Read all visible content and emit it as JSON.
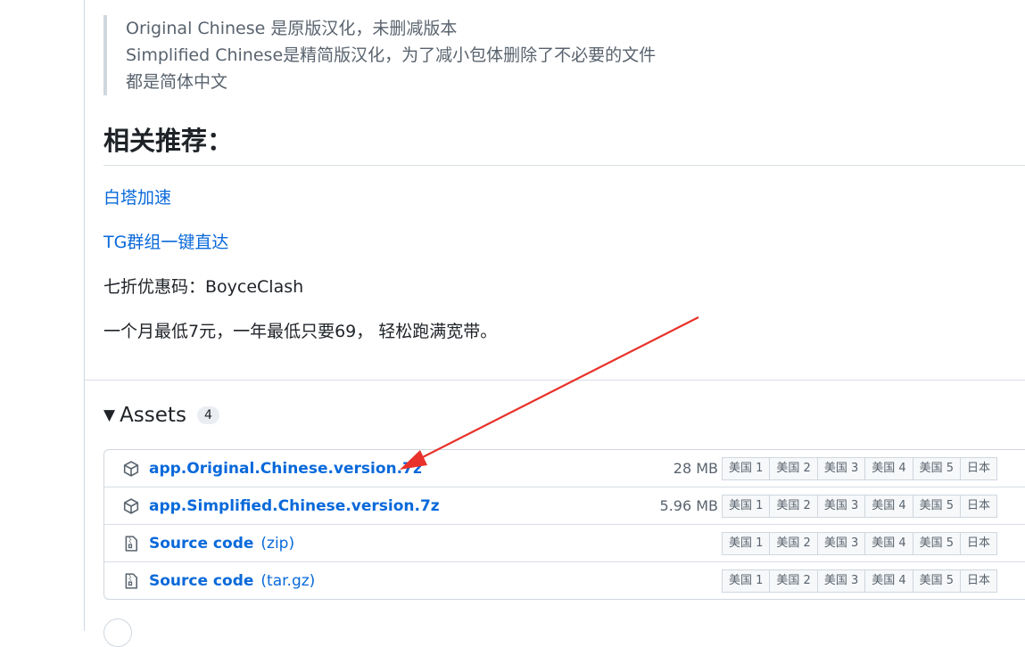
{
  "quote": {
    "lines": [
      "Original Chinese 是原版汉化，未删减版本",
      "Simplified Chinese是精简版汉化，为了减小包体删除了不必要的文件",
      "都是简体中文"
    ]
  },
  "recommend": {
    "heading": "相关推荐：",
    "link1": "白塔加速",
    "link2": "TG群组一键直达",
    "coupon": "七折优惠码：BoyceClash",
    "price": "一个月最低7元，一年最低只要69， 轻松跑满宽带。"
  },
  "assets": {
    "title": "Assets",
    "count": "4",
    "rows": [
      {
        "name": "app.Original.Chinese.version.7z",
        "ext": "",
        "size": "28 MB",
        "icon": "package-icon"
      },
      {
        "name": "app.Simplified.Chinese.version.7z",
        "ext": "",
        "size": "5.96 MB",
        "icon": "package-icon"
      },
      {
        "name": "Source code",
        "ext": "(zip)",
        "size": "",
        "icon": "file-zip-icon"
      },
      {
        "name": "Source code",
        "ext": "(tar.gz)",
        "size": "",
        "icon": "file-zip-icon"
      }
    ],
    "mirrors": [
      "美国 1",
      "美国 2",
      "美国 3",
      "美国 4",
      "美国 5",
      "日本"
    ]
  },
  "annotation": {
    "arrow_color": "#e8322b"
  }
}
